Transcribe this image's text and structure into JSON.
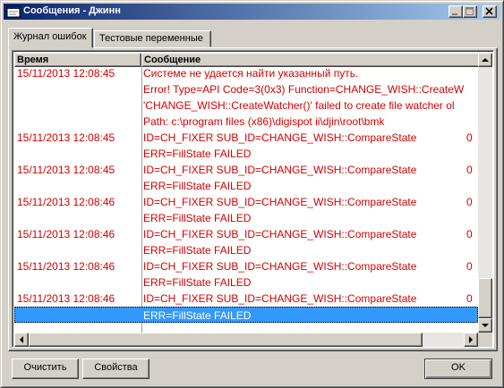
{
  "window": {
    "title": "Сообщения - Джинн",
    "icon": "app-icon"
  },
  "tabs": [
    {
      "label": "Журнал ошибок",
      "active": true
    },
    {
      "label": "Тестовые переменные",
      "active": false
    }
  ],
  "list": {
    "columns": [
      "Время",
      "Сообщение"
    ],
    "rows": [
      {
        "time": "15/11/2013 12:08:45",
        "message": "Системе не удается найти указанный путь.",
        "extra": ""
      },
      {
        "time": "",
        "message": "Error! Type=API Code=3(0x3) Function=CHANGE_WISH::CreateW",
        "extra": ""
      },
      {
        "time": "",
        "message": "'CHANGE_WISH::CreateWatcher()' failed to create file watcher ol",
        "extra": ""
      },
      {
        "time": "",
        "message": "Path: c:\\program files (x86)\\digispot ii\\djin\\root\\bmk",
        "extra": ""
      },
      {
        "time": "15/11/2013 12:08:45",
        "message": "ID=CH_FIXER SUB_ID=CHANGE_WISH::CompareState",
        "extra": "0"
      },
      {
        "time": "",
        "message": "ERR=FillState FAILED",
        "extra": ""
      },
      {
        "time": "15/11/2013 12:08:45",
        "message": "ID=CH_FIXER SUB_ID=CHANGE_WISH::CompareState",
        "extra": "0"
      },
      {
        "time": "",
        "message": "ERR=FillState FAILED",
        "extra": ""
      },
      {
        "time": "15/11/2013 12:08:46",
        "message": "ID=CH_FIXER SUB_ID=CHANGE_WISH::CompareState",
        "extra": "0"
      },
      {
        "time": "",
        "message": "ERR=FillState FAILED",
        "extra": ""
      },
      {
        "time": "15/11/2013 12:08:46",
        "message": "ID=CH_FIXER SUB_ID=CHANGE_WISH::CompareState",
        "extra": "0"
      },
      {
        "time": "",
        "message": "ERR=FillState FAILED",
        "extra": ""
      },
      {
        "time": "15/11/2013 12:08:46",
        "message": "ID=CH_FIXER SUB_ID=CHANGE_WISH::CompareState",
        "extra": "0"
      },
      {
        "time": "",
        "message": "ERR=FillState FAILED",
        "extra": ""
      },
      {
        "time": "15/11/2013 12:08:46",
        "message": "ID=CH_FIXER SUB_ID=CHANGE_WISH::CompareState",
        "extra": "0"
      },
      {
        "time": "",
        "message": "ERR=FillState FAILED",
        "extra": "",
        "selected": true
      }
    ]
  },
  "buttons": {
    "clear": "Очистить",
    "properties": "Свойства",
    "ok": "OK"
  },
  "colors": {
    "error_text": "#d40000",
    "selection": "#3399ff",
    "title_start": "#0a246a",
    "title_end": "#a6caf0"
  }
}
